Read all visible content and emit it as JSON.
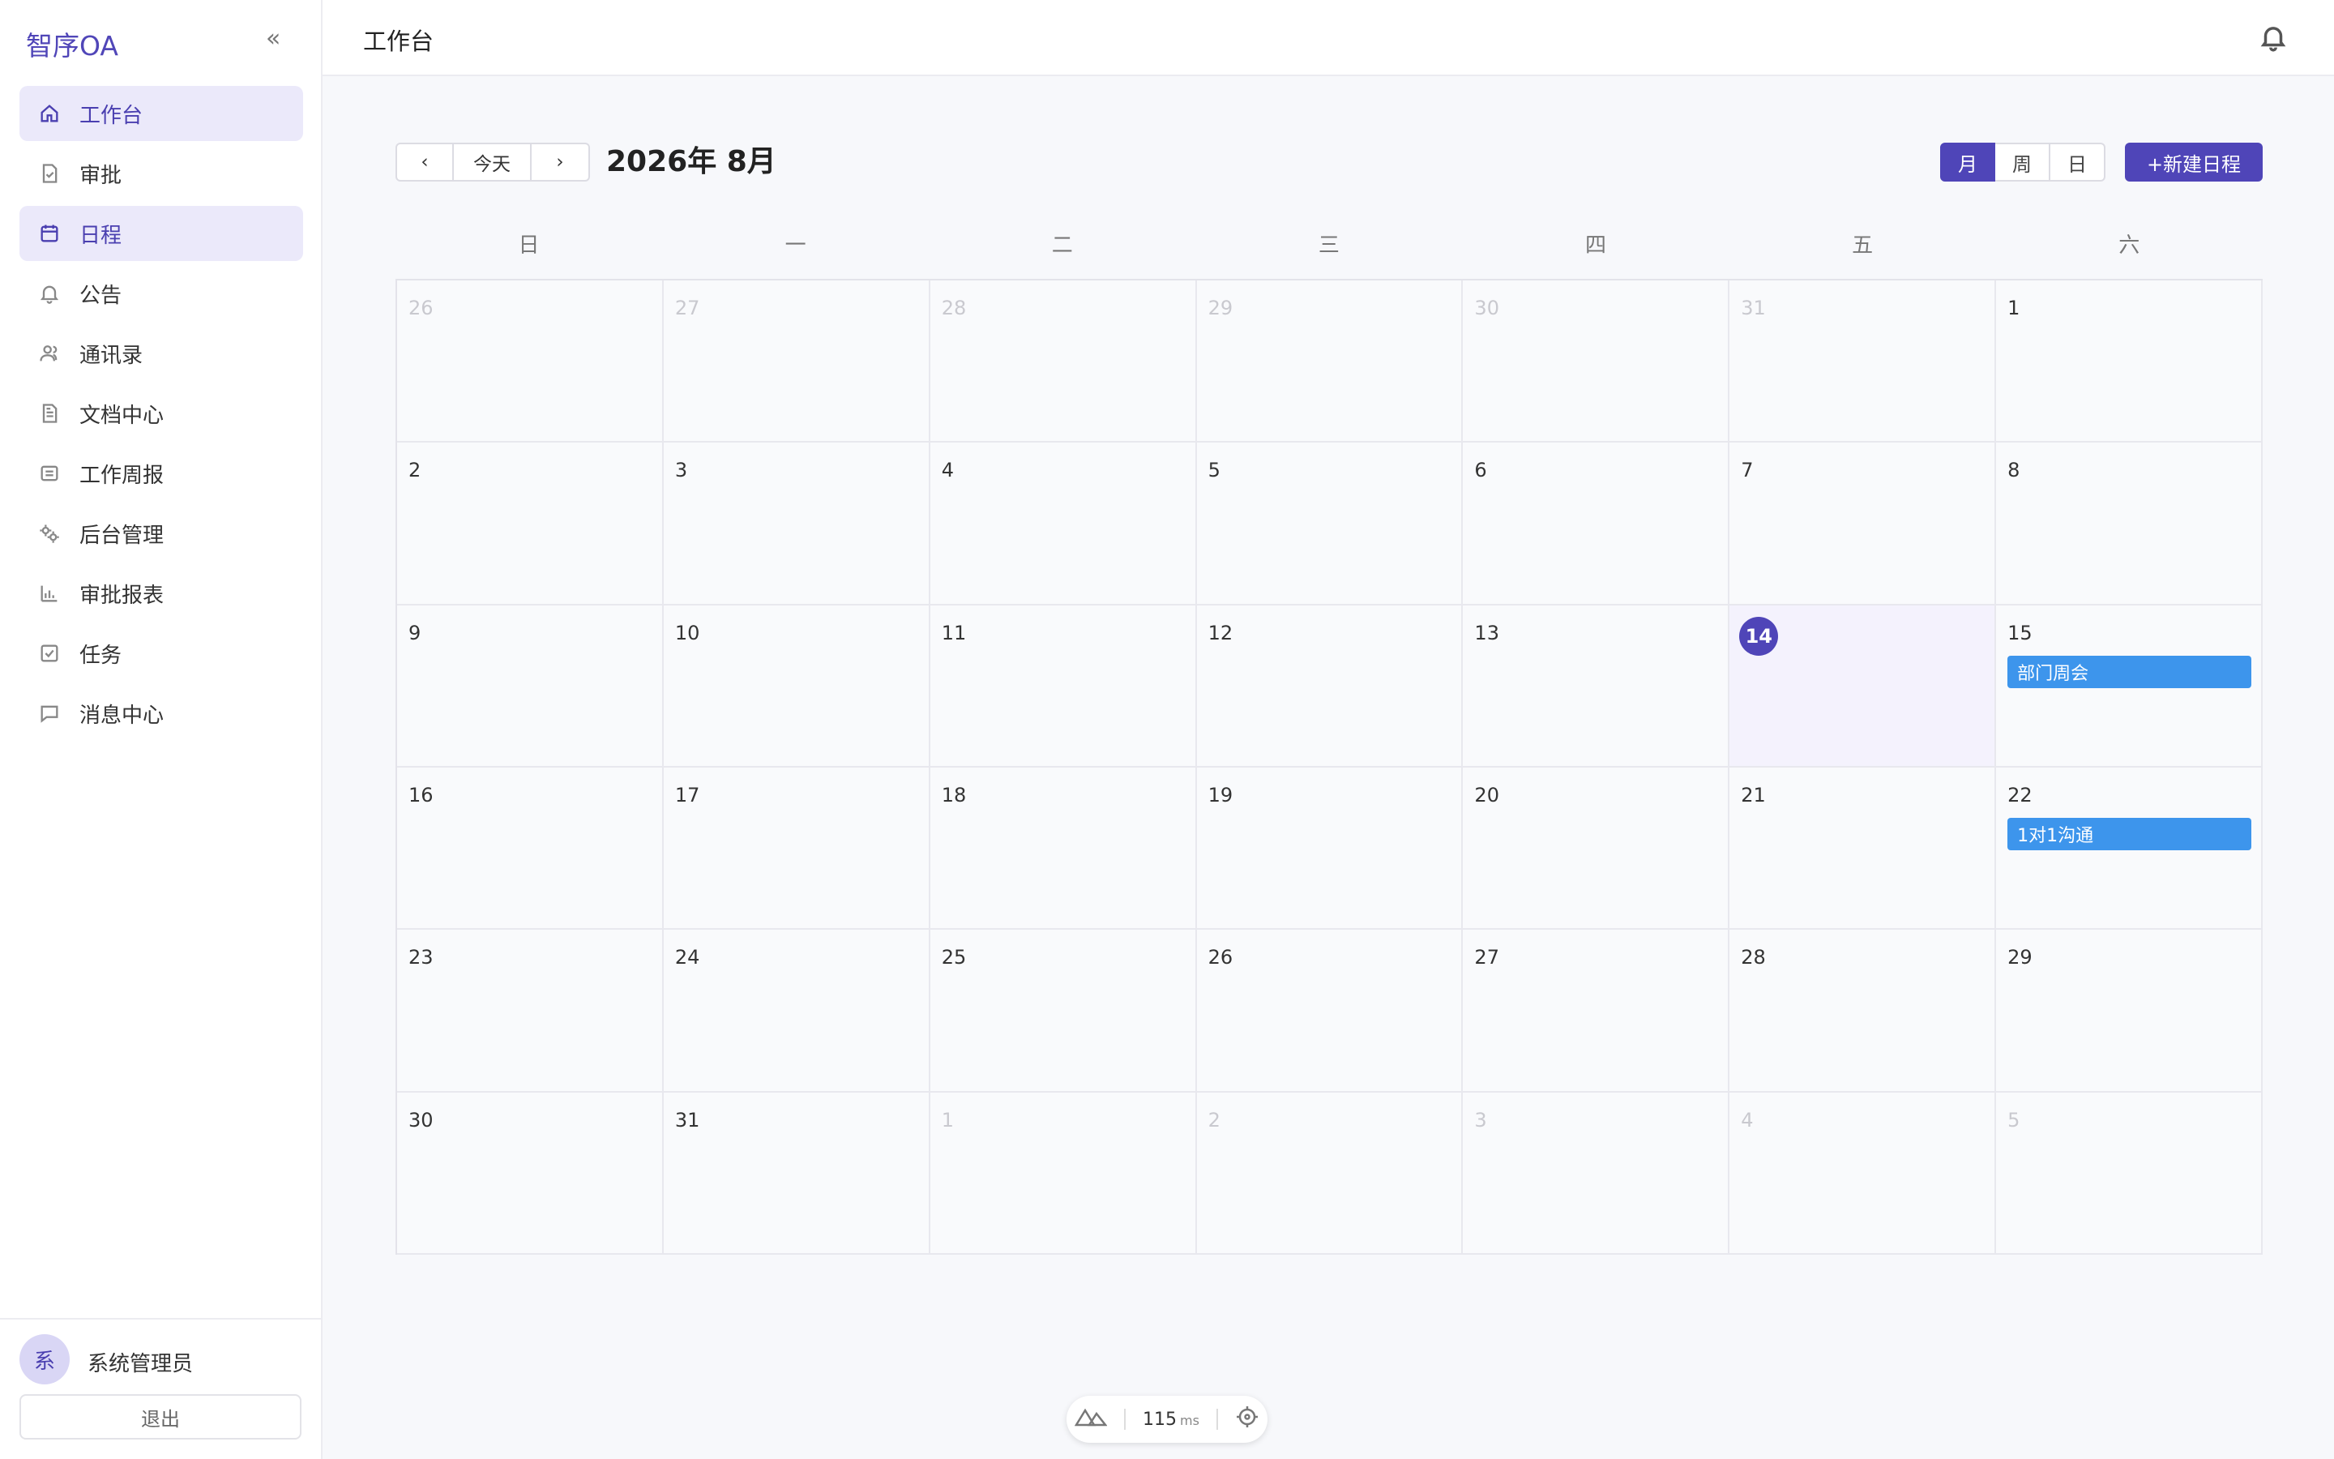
{
  "app": {
    "brand": "智序OA",
    "collapse_glyph": "«"
  },
  "sidebar": {
    "items": [
      {
        "label": "工作台",
        "icon": "home-icon",
        "active": true
      },
      {
        "label": "审批",
        "icon": "approval-doc-icon",
        "active": false
      },
      {
        "label": "日程",
        "icon": "calendar-icon",
        "active": true
      },
      {
        "label": "公告",
        "icon": "bell-icon",
        "active": false
      },
      {
        "label": "通讯录",
        "icon": "contacts-icon",
        "active": false
      },
      {
        "label": "文档中心",
        "icon": "document-icon",
        "active": false
      },
      {
        "label": "工作周报",
        "icon": "report-list-icon",
        "active": false
      },
      {
        "label": "后台管理",
        "icon": "admin-gears-icon",
        "active": false
      },
      {
        "label": "审批报表",
        "icon": "bar-chart-icon",
        "active": false
      },
      {
        "label": "任务",
        "icon": "task-check-icon",
        "active": false
      },
      {
        "label": "消息中心",
        "icon": "message-icon",
        "active": false
      }
    ],
    "user": {
      "avatar_text": "系",
      "name": "系统管理员"
    },
    "logout_label": "退出"
  },
  "header": {
    "title": "工作台",
    "bell_icon": "bell-icon"
  },
  "toolbar": {
    "prev_glyph": "‹",
    "today_label": "今天",
    "next_glyph": "›",
    "month_title": "2026年 8月",
    "views": [
      {
        "label": "月",
        "active": true
      },
      {
        "label": "周",
        "active": false
      },
      {
        "label": "日",
        "active": false
      }
    ],
    "new_event_label": "+新建日程"
  },
  "calendar": {
    "weekdays": [
      "日",
      "一",
      "二",
      "三",
      "四",
      "五",
      "六"
    ],
    "weeks": [
      [
        {
          "day": "26",
          "out": true
        },
        {
          "day": "27",
          "out": true
        },
        {
          "day": "28",
          "out": true
        },
        {
          "day": "29",
          "out": true
        },
        {
          "day": "30",
          "out": true
        },
        {
          "day": "31",
          "out": true
        },
        {
          "day": "1"
        }
      ],
      [
        {
          "day": "2"
        },
        {
          "day": "3"
        },
        {
          "day": "4"
        },
        {
          "day": "5"
        },
        {
          "day": "6"
        },
        {
          "day": "7"
        },
        {
          "day": "8"
        }
      ],
      [
        {
          "day": "9"
        },
        {
          "day": "10"
        },
        {
          "day": "11"
        },
        {
          "day": "12"
        },
        {
          "day": "13"
        },
        {
          "day": "14",
          "today": true
        },
        {
          "day": "15",
          "events": [
            "部门周会"
          ]
        }
      ],
      [
        {
          "day": "16"
        },
        {
          "day": "17"
        },
        {
          "day": "18"
        },
        {
          "day": "19"
        },
        {
          "day": "20"
        },
        {
          "day": "21"
        },
        {
          "day": "22",
          "events": [
            "1对1沟通"
          ]
        }
      ],
      [
        {
          "day": "23"
        },
        {
          "day": "24"
        },
        {
          "day": "25"
        },
        {
          "day": "26"
        },
        {
          "day": "27"
        },
        {
          "day": "28"
        },
        {
          "day": "29"
        }
      ],
      [
        {
          "day": "30"
        },
        {
          "day": "31"
        },
        {
          "day": "1",
          "out": true
        },
        {
          "day": "2",
          "out": true
        },
        {
          "day": "3",
          "out": true
        },
        {
          "day": "4",
          "out": true
        },
        {
          "day": "5",
          "out": true
        }
      ]
    ]
  },
  "dev_toolbar": {
    "ms_value": "115",
    "ms_unit": "ms"
  },
  "colors": {
    "accent": "#4f45b8",
    "event": "#3d95ec",
    "active_bg": "#ebe9fa"
  }
}
